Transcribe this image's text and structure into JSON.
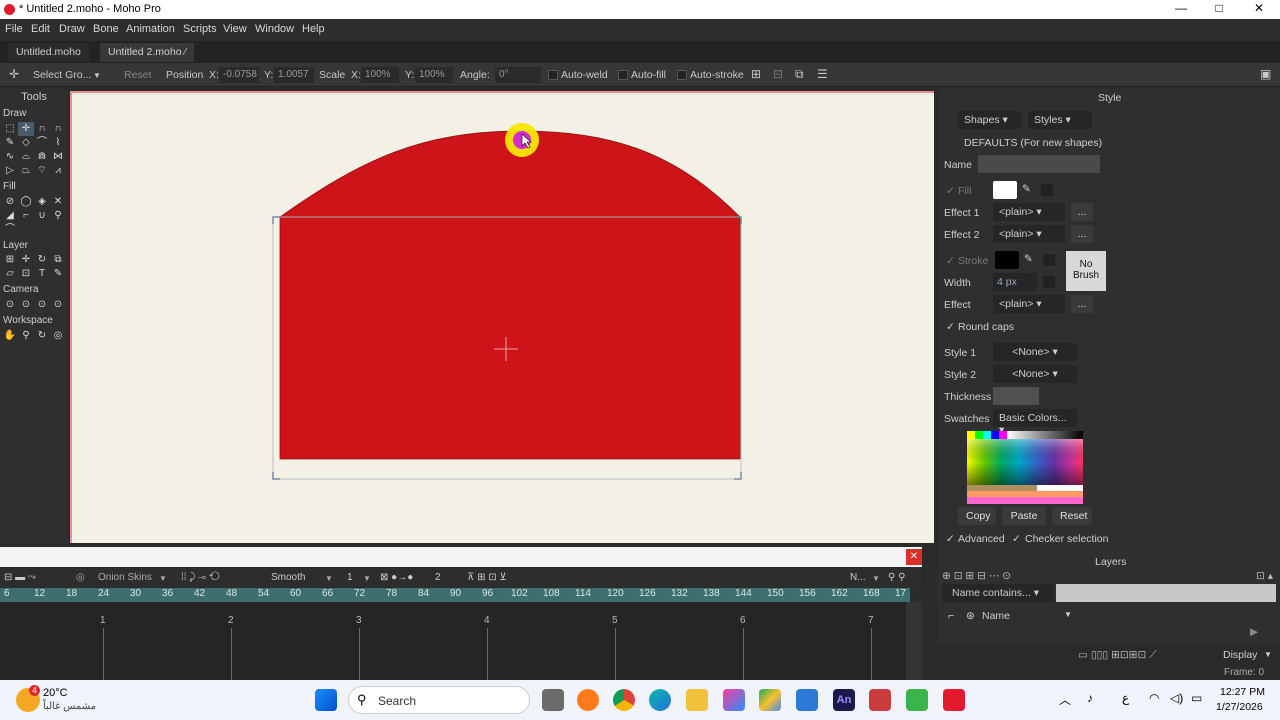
{
  "window": {
    "title": "* Untitled 2.moho - Moho Pro",
    "controls": [
      "—",
      "□",
      "✕"
    ]
  },
  "menu": [
    "File",
    "Edit",
    "Draw",
    "Bone",
    "Animation",
    "Scripts",
    "View",
    "Window",
    "Help"
  ],
  "tabs": [
    {
      "label": "Untitled.moho"
    },
    {
      "label": "Untitled 2.moho ∕"
    }
  ],
  "toolbar": {
    "select_group": "Select Gro...",
    "reset": "Reset",
    "position_label": "Position",
    "x_label": "X:",
    "x_value": "-0.0758",
    "y_label": "Y:",
    "y_value": "1.0057",
    "scale_label": "Scale",
    "scale_x_label": "X:",
    "scale_x_value": "100%",
    "scale_y_label": "Y:",
    "scale_y_value": "100%",
    "angle_label": "Angle:",
    "angle_value": "0°",
    "auto_weld": "Auto-weld",
    "auto_fill": "Auto-fill",
    "auto_stroke": "Auto-stroke"
  },
  "tools": {
    "title": "Tools",
    "sections": [
      "Draw",
      "Fill",
      "Layer",
      "Camera",
      "Workspace"
    ]
  },
  "style_panel": {
    "title": "Style",
    "shapes_btn": "Shapes",
    "styles_btn": "Styles",
    "defaults": "DEFAULTS (For new shapes)",
    "name_label": "Name",
    "fill_label": "Fill",
    "effect1_label": "Effect 1",
    "effect1_value": "<plain>",
    "effect2_label": "Effect 2",
    "effect2_value": "<plain>",
    "stroke_label": "Stroke",
    "width_label": "Width",
    "width_value": "4 px",
    "effect_label": "Effect",
    "effect_value": "<plain>",
    "no_brush": "No Brush",
    "round_caps": "Round caps",
    "style1_label": "Style 1",
    "style1_value": "<None>",
    "style2_label": "Style 2",
    "style2_value": "<None>",
    "thickness_label": "Thickness",
    "swatches_label": "Swatches",
    "swatches_value": "Basic Colors...",
    "copy": "Copy",
    "paste": "Paste",
    "reset": "Reset",
    "advanced": "Advanced",
    "checker_selection": "Checker selection",
    "more": "..."
  },
  "colors": {
    "shape_fill": "#cc1419",
    "canvas_bg": "#f3f1e6",
    "fill_swatch": "#ffffff",
    "stroke_swatch": "#000000"
  },
  "timeline": {
    "onion_skins": "Onion Skins",
    "smooth": "Smooth",
    "step": "1",
    "keys": "2",
    "n_label": "N...",
    "ruler": [
      "6",
      "12",
      "18",
      "24",
      "30",
      "36",
      "42",
      "48",
      "54",
      "60",
      "66",
      "72",
      "78",
      "84",
      "90",
      "96",
      "102",
      "108",
      "114",
      "120",
      "126",
      "132",
      "138",
      "144",
      "150",
      "156",
      "162",
      "168",
      "17"
    ],
    "seconds": [
      "1",
      "2",
      "3",
      "4",
      "5",
      "6",
      "7"
    ]
  },
  "layers_panel": {
    "title": "Layers",
    "filter": "Name contains...",
    "name_col": "Name",
    "display": "Display",
    "frame": "Frame: 0"
  },
  "taskbar": {
    "temp": "20°C",
    "weather": "مشمس غالباً",
    "badge": "4",
    "search": "Search",
    "time": "12:27 PM",
    "date": "1/27/2026",
    "lang": "ع"
  }
}
